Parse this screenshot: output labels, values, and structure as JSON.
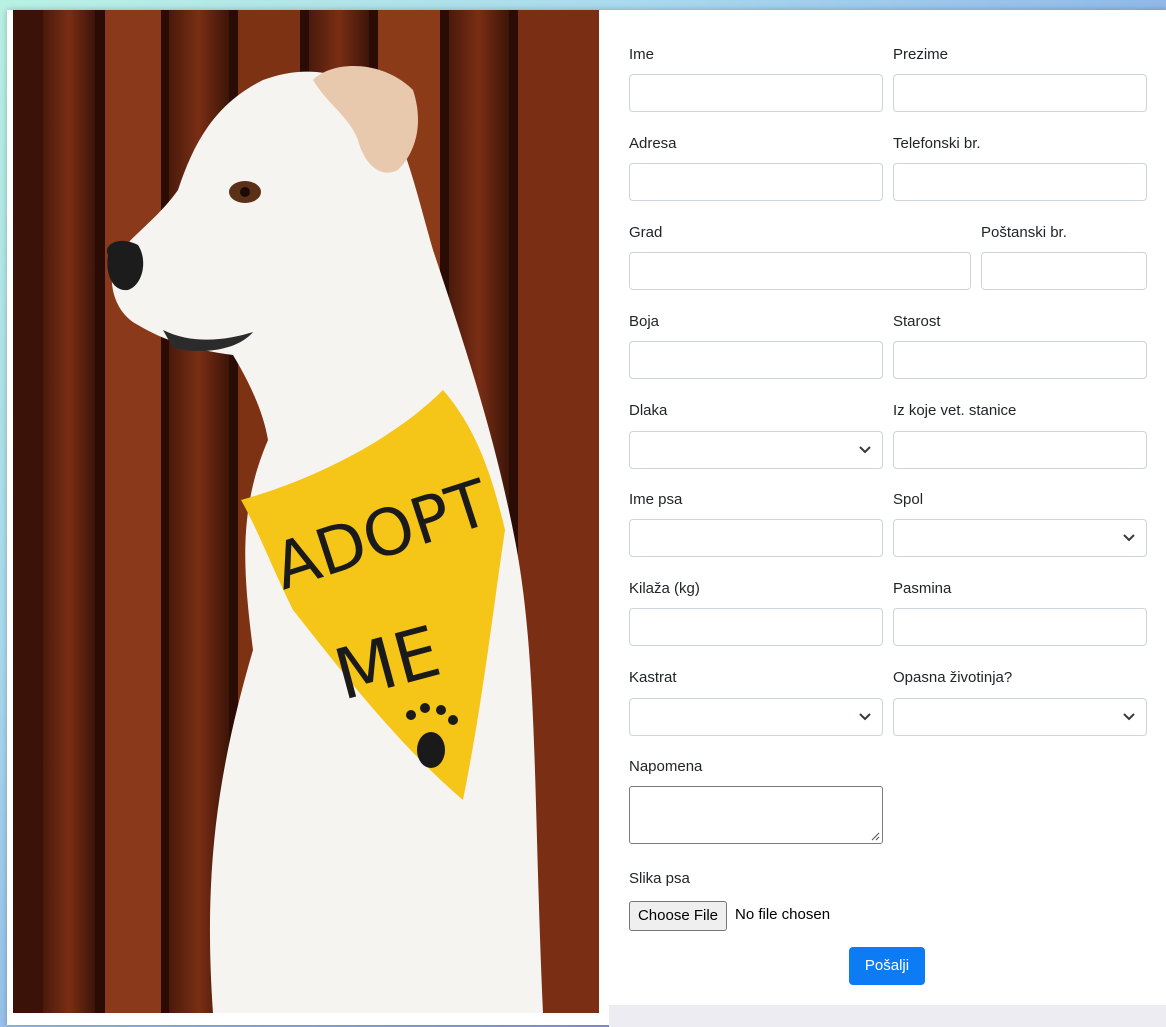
{
  "photo": {
    "alt": "Dog wearing an ADOPT ME bandana",
    "bandana_text_line1": "ADOPT",
    "bandana_text_line2": "ME"
  },
  "form": {
    "ime_label": "Ime",
    "prezime_label": "Prezime",
    "adresa_label": "Adresa",
    "telefon_label": "Telefonski br.",
    "grad_label": "Grad",
    "postanski_label": "Poštanski br.",
    "boja_label": "Boja",
    "starost_label": "Starost",
    "dlaka_label": "Dlaka",
    "vet_stanica_label": "Iz koje vet. stanice",
    "ime_psa_label": "Ime psa",
    "spol_label": "Spol",
    "kilaza_label": "Kilaža (kg)",
    "pasmina_label": "Pasmina",
    "kastrat_label": "Kastrat",
    "opasna_label": "Opasna životinja?",
    "napomena_label": "Napomena",
    "slika_label": "Slika psa",
    "choose_file_label": "Choose File",
    "no_file_text": "No file chosen",
    "submit_label": "Pošalji"
  },
  "colors": {
    "primary": "#0d7bf4",
    "border": "#ced4da",
    "bandana": "#f5c518"
  },
  "icons": {
    "select_arrow": "chevron-down-icon",
    "resize": "resize-grip-icon"
  }
}
